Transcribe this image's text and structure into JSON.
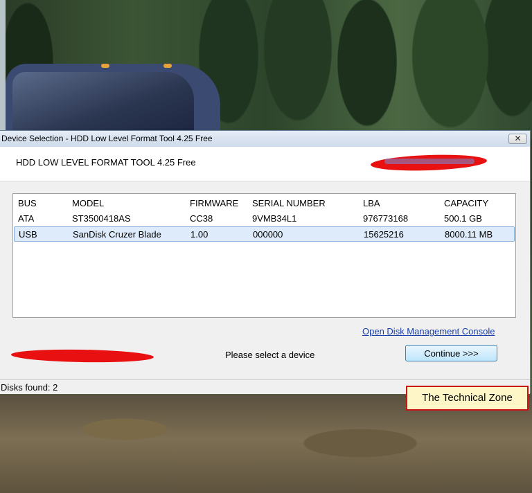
{
  "window": {
    "title": "Device Selection - HDD Low Level Format Tool 4.25    Free",
    "close_glyph": "✕",
    "heading": "HDD LOW LEVEL FORMAT TOOL 4.25    Free"
  },
  "device_list": {
    "columns": [
      "BUS",
      "MODEL",
      "FIRMWARE",
      "SERIAL NUMBER",
      "LBA",
      "CAPACITY"
    ],
    "rows": [
      {
        "bus": "ATA",
        "model": "ST3500418AS",
        "firmware": "CC38",
        "serial": "9VMB34L1",
        "lba": "976773168",
        "capacity": "500.1 GB",
        "selected": false
      },
      {
        "bus": "USB",
        "model": "SanDisk Cruzer Blade",
        "firmware": "1.00",
        "serial": "000000",
        "lba": "15625216",
        "capacity": "8000.11 MB",
        "selected": true
      }
    ]
  },
  "actions": {
    "disk_mgmt_link": "Open Disk Management Console",
    "status_message": "Please select a device",
    "continue_label": "Continue >>>"
  },
  "statusbar": {
    "text": "Disks found: 2"
  },
  "watermark": {
    "text": "The Technical Zone"
  },
  "colors": {
    "redaction": "#e81010",
    "selection": "#ddebfa",
    "link": "#1a3ea8"
  }
}
